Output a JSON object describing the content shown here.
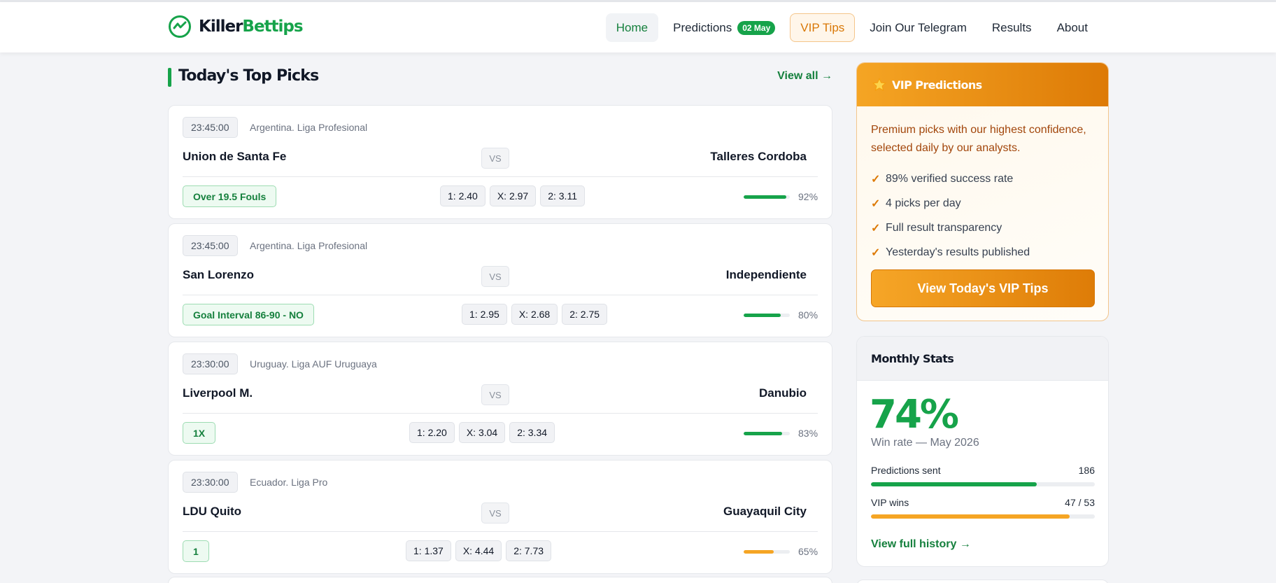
{
  "brand": {
    "name_part1": "Killer",
    "name_part2": "Bettips",
    "accent": "#16a34a"
  },
  "nav": {
    "home": "Home",
    "predictions": "Predictions",
    "predictions_badge": "02 May",
    "vip": "VIP Tips",
    "telegram": "Join Our Telegram",
    "results": "Results",
    "about": "About"
  },
  "section": {
    "title": "Today's Top Picks",
    "view_all": "View all →"
  },
  "matches": [
    {
      "time": "23:45:00",
      "league": "Argentina. Liga Profesional",
      "home": "Union de Santa Fe",
      "vs": "VS",
      "away": "Talleres Cordoba",
      "tip": "Over 19.5 Fouls",
      "odd_1": "1: 2.40",
      "odd_x": "X: 2.97",
      "odd_2": "2: 3.11",
      "confidence": 92,
      "confidence_label": "92%",
      "bar_color": "#16a34a"
    },
    {
      "time": "23:45:00",
      "league": "Argentina. Liga Profesional",
      "home": "San Lorenzo",
      "vs": "VS",
      "away": "Independiente",
      "tip": "Goal Interval 86-90 - NO",
      "odd_1": "1: 2.95",
      "odd_x": "X: 2.68",
      "odd_2": "2: 2.75",
      "confidence": 80,
      "confidence_label": "80%",
      "bar_color": "#16a34a"
    },
    {
      "time": "23:30:00",
      "league": "Uruguay. Liga AUF Uruguaya",
      "home": "Liverpool M.",
      "vs": "VS",
      "away": "Danubio",
      "tip": "1X",
      "odd_1": "1: 2.20",
      "odd_x": "X: 3.04",
      "odd_2": "2: 3.34",
      "confidence": 83,
      "confidence_label": "83%",
      "bar_color": "#16a34a"
    },
    {
      "time": "23:30:00",
      "league": "Ecuador. Liga Pro",
      "home": "LDU Quito",
      "vs": "VS",
      "away": "Guayaquil City",
      "tip": "1",
      "odd_1": "1: 1.37",
      "odd_x": "X: 4.44",
      "odd_2": "2: 7.73",
      "confidence": 65,
      "confidence_label": "65%",
      "bar_color": "#f5a524"
    }
  ],
  "vip": {
    "title": "VIP Predictions",
    "icon": "star-icon",
    "description": "Premium picks with our highest confidence, selected daily by our analysts.",
    "features": [
      "89% verified success rate",
      "4 picks per day",
      "Full result transparency",
      "Yesterday's results published"
    ],
    "check": "✓",
    "button": "View Today's VIP Tips",
    "accent": "#dd7a06"
  },
  "stats": {
    "title": "Monthly Stats",
    "win_rate": "74%",
    "win_rate_label": "Win rate — May 2026",
    "rows": [
      {
        "label": "Predictions sent",
        "value": "186",
        "fill": 0.74,
        "color": "#16a34a"
      },
      {
        "label": "VIP wins",
        "value": "47 / 53",
        "fill": 0.887,
        "color": "#f5a524"
      }
    ],
    "history": "View full history →"
  }
}
